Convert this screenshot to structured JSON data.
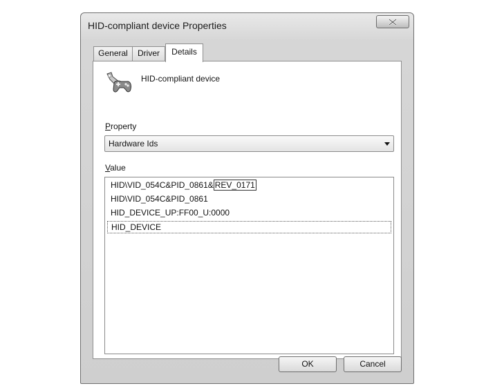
{
  "window": {
    "title": "HID-compliant device Properties",
    "close_label": "X"
  },
  "tabs": [
    {
      "label": "General",
      "active": false
    },
    {
      "label": "Driver",
      "active": false
    },
    {
      "label": "Details",
      "active": true
    }
  ],
  "device": {
    "icon": "game-controller-icon",
    "name": "HID-compliant device"
  },
  "property": {
    "label": "Property",
    "selected": "Hardware Ids"
  },
  "value": {
    "label": "Value",
    "items": [
      {
        "prefix": "HID\\VID_054C&PID_0861&",
        "highlight": "REV_0171"
      },
      {
        "text": "HID\\VID_054C&PID_0861"
      },
      {
        "text": "HID_DEVICE_UP:FF00_U:0000"
      },
      {
        "text": "HID_DEVICE"
      }
    ]
  },
  "buttons": {
    "ok": "OK",
    "cancel": "Cancel"
  }
}
